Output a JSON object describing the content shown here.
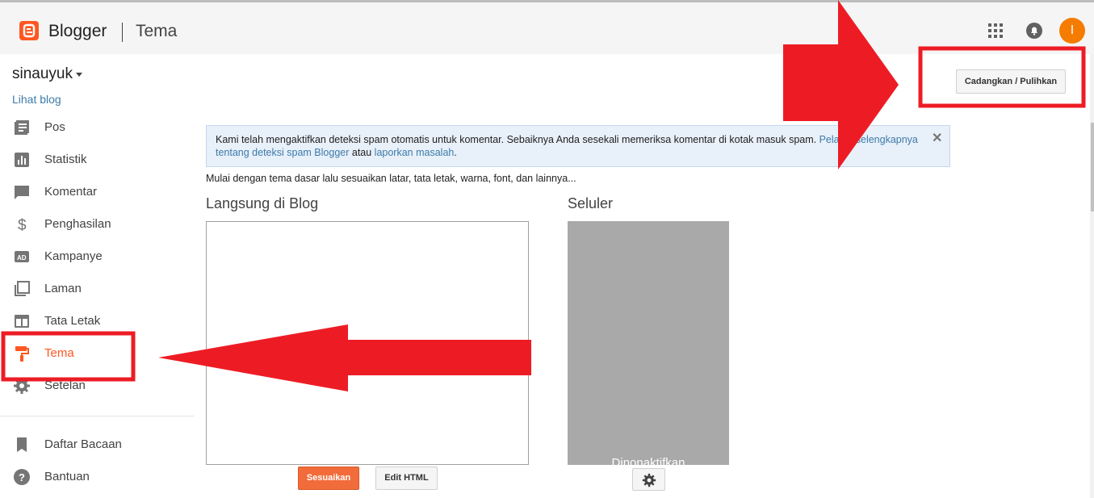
{
  "header": {
    "brand": "Blogger",
    "page_title": "Tema",
    "avatar_initial": "I"
  },
  "sidebar": {
    "blog_name": "sinauyuk",
    "view_blog": "Lihat blog",
    "items": [
      {
        "label": "Pos",
        "icon": "posts-icon"
      },
      {
        "label": "Statistik",
        "icon": "stats-icon"
      },
      {
        "label": "Komentar",
        "icon": "comment-icon"
      },
      {
        "label": "Penghasilan",
        "icon": "dollar-icon"
      },
      {
        "label": "Kampanye",
        "icon": "ad-icon"
      },
      {
        "label": "Laman",
        "icon": "pages-icon"
      },
      {
        "label": "Tata Letak",
        "icon": "layout-icon"
      },
      {
        "label": "Tema",
        "icon": "paint-roller-icon",
        "active": true
      },
      {
        "label": "Setelan",
        "icon": "gear-icon"
      }
    ],
    "secondary": [
      {
        "label": "Daftar Bacaan",
        "icon": "bookmark-icon"
      },
      {
        "label": "Bantuan",
        "icon": "help-icon"
      }
    ]
  },
  "main": {
    "backup_button": "Cadangkan / Pulihkan",
    "notice": {
      "text_before": "Kami telah mengaktifkan deteksi spam otomatis untuk komentar. Sebaiknya Anda sesekali memeriksa komentar di kotak masuk spam. ",
      "link1": "Pelajari selengkapnya tentang deteksi spam Blogger",
      "text_between": " atau ",
      "link2": "laporkan masalah",
      "text_after": ".",
      "close": "✕"
    },
    "intro": "Mulai dengan tema dasar lalu sesuaikan latar, tata letak, warna, font, dan lainnya...",
    "live_title": "Langsung di Blog",
    "mobile_title": "Seluler",
    "mobile_status": "Dinonaktifkan",
    "customize_button": "Sesuaikan",
    "edit_html_button": "Edit HTML"
  },
  "colors": {
    "accent": "#ff5722",
    "annotation_red": "#ed1c24",
    "link": "#3d7ba8"
  }
}
